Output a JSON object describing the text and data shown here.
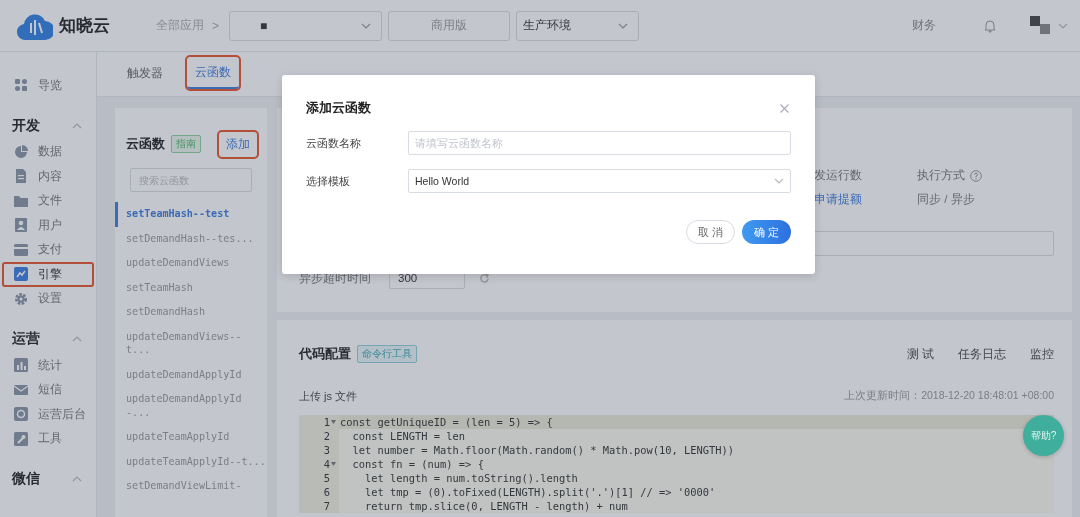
{
  "header": {
    "logo_text": "知晓云",
    "breadcrumb": "全部应用",
    "breadcrumb_separator": ">",
    "app_select": "■",
    "edition": "商用版",
    "environment": "生产环境",
    "finance_link": "财务"
  },
  "sidebar": {
    "items": [
      {
        "label": "导览",
        "kind": "grid",
        "selected": false,
        "annotated": false
      }
    ],
    "sections": [
      {
        "title": "开发",
        "expanded": true,
        "items": [
          {
            "label": "数据",
            "kind": "pie",
            "selected": false,
            "annotated": false
          },
          {
            "label": "内容",
            "kind": "doc",
            "selected": false,
            "annotated": false
          },
          {
            "label": "文件",
            "kind": "folder",
            "selected": false,
            "annotated": false
          },
          {
            "label": "用户",
            "kind": "user",
            "selected": false,
            "annotated": false
          },
          {
            "label": "支付",
            "kind": "card",
            "selected": false,
            "annotated": false
          },
          {
            "label": "引擎",
            "kind": "chart",
            "selected": true,
            "annotated": true
          },
          {
            "label": "设置",
            "kind": "gear",
            "selected": false,
            "annotated": false
          }
        ]
      },
      {
        "title": "运营",
        "expanded": true,
        "items": [
          {
            "label": "统计",
            "kind": "bars",
            "selected": false,
            "annotated": false
          },
          {
            "label": "短信",
            "kind": "mail",
            "selected": false,
            "annotated": false
          },
          {
            "label": "运营后台",
            "kind": "target",
            "selected": false,
            "annotated": false
          },
          {
            "label": "工具",
            "kind": "wrench",
            "selected": false,
            "annotated": false
          }
        ]
      },
      {
        "title": "微信",
        "expanded": true
      }
    ]
  },
  "tabs": [
    {
      "label": "触发器",
      "selected": false,
      "annotated": false
    },
    {
      "label": "云函数",
      "selected": true,
      "annotated": true
    }
  ],
  "functions": {
    "title": "云函数",
    "tag": "指南",
    "add_button": {
      "label": "添加",
      "annotated": true
    },
    "search": {
      "placeholder": "搜索云函数"
    },
    "items": [
      {
        "name": "setTeamHash--test",
        "selected": true
      },
      {
        "name": "setDemandHash--tes...",
        "selected": false
      },
      {
        "name": "updateDemandViews",
        "selected": false
      },
      {
        "name": "setTeamHash",
        "selected": false
      },
      {
        "name": "setDemandHash",
        "selected": false
      },
      {
        "name": "updateDemandViews--\nt...",
        "selected": false
      },
      {
        "name": "updateDemandApplyId",
        "selected": false
      },
      {
        "name": "updateDemandApplyId\n-...",
        "selected": false
      },
      {
        "name": "updateTeamApplyId",
        "selected": false
      },
      {
        "name": "updateTeamApplyId--t...",
        "selected": false
      },
      {
        "name": "setDemandViewLimit-",
        "selected": false
      }
    ]
  },
  "detail": {
    "stats": [
      {
        "label": "发运行数",
        "value": "申请提额",
        "kind": "link"
      },
      {
        "label": "执行方式",
        "help": true,
        "value": "同步 / 异步",
        "kind": "text"
      }
    ],
    "timeout": {
      "label": "异步超时时间",
      "value": "300"
    }
  },
  "code": {
    "title": "代码配置",
    "tag": "命令行工具",
    "actions": [
      "测 试",
      "任务日志",
      "监控"
    ],
    "upload_label": "上传 js 文件",
    "updated": "上次更新时间：2018-12-20 18:48:01 +08:00",
    "lines": [
      {
        "number": "1",
        "fold": true,
        "active": true,
        "text": "const getUniqueID = (len = 5) => {"
      },
      {
        "number": "2",
        "fold": false,
        "active": false,
        "text": "  const LENGTH = len"
      },
      {
        "number": "3",
        "fold": false,
        "active": false,
        "text": "  let number = Math.floor(Math.random() * Math.pow(10, LENGTH))"
      },
      {
        "number": "4",
        "fold": true,
        "active": false,
        "text": "  const fn = (num) => {"
      },
      {
        "number": "5",
        "fold": false,
        "active": false,
        "text": "    let length = num.toString().length"
      },
      {
        "number": "6",
        "fold": false,
        "active": false,
        "text": "    let tmp = (0).toFixed(LENGTH).split('.')[1] // => '0000'"
      },
      {
        "number": "7",
        "fold": false,
        "active": false,
        "text": "    return tmp.slice(0, LENGTH - length) + num"
      }
    ]
  },
  "help_button": "帮助?",
  "dialog": {
    "title": "添加云函数",
    "fields": [
      {
        "label": "云函数名称",
        "kind": "input",
        "placeholder": "请填写云函数名称"
      },
      {
        "label": "选择模板",
        "kind": "select",
        "value": "Hello World"
      }
    ],
    "buttons": [
      {
        "label": "取 消",
        "kind": "secondary"
      },
      {
        "label": "确 定",
        "kind": "primary"
      }
    ]
  }
}
